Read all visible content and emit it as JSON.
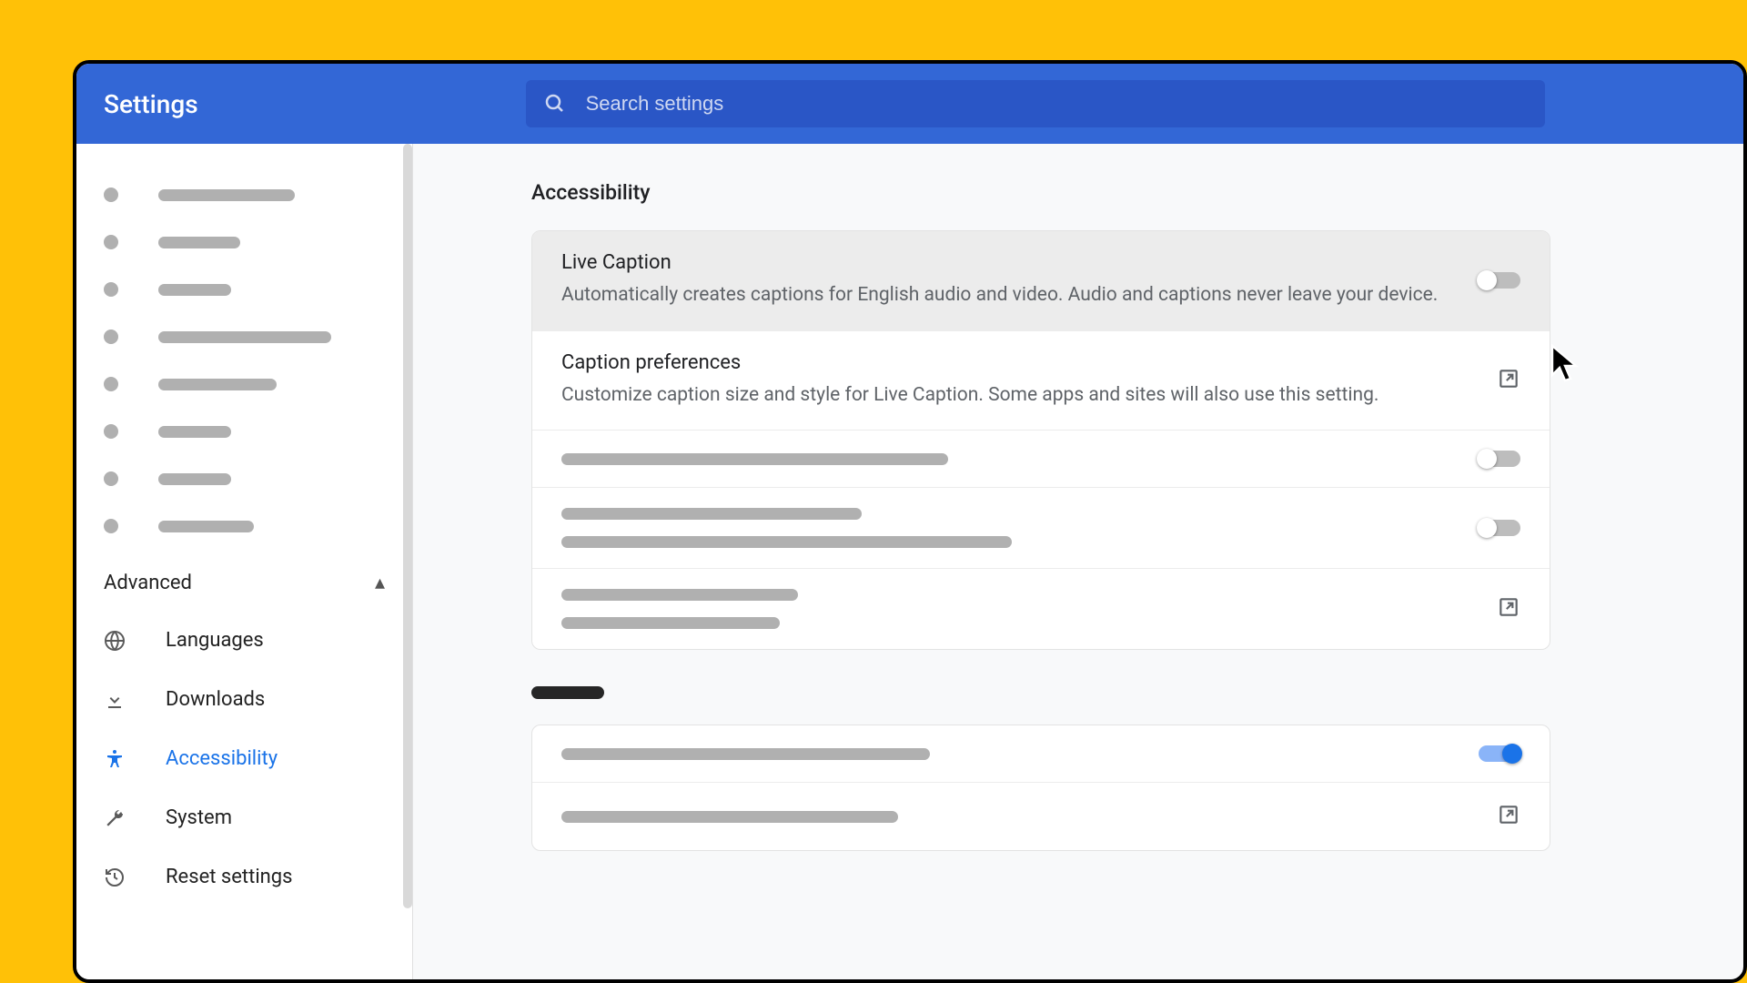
{
  "header": {
    "title": "Settings",
    "search_placeholder": "Search settings"
  },
  "sidebar": {
    "advanced_label": "Advanced",
    "items": {
      "languages": "Languages",
      "downloads": "Downloads",
      "accessibility": "Accessibility",
      "system": "System",
      "reset": "Reset settings"
    }
  },
  "main": {
    "section_title": "Accessibility",
    "rows": {
      "live_caption": {
        "title": "Live Caption",
        "desc": "Automatically creates captions for English audio and video. Audio and captions never leave your device."
      },
      "caption_prefs": {
        "title": "Caption preferences",
        "desc": "Customize caption size and style for Live Caption. Some apps and sites will also use this setting."
      }
    }
  }
}
